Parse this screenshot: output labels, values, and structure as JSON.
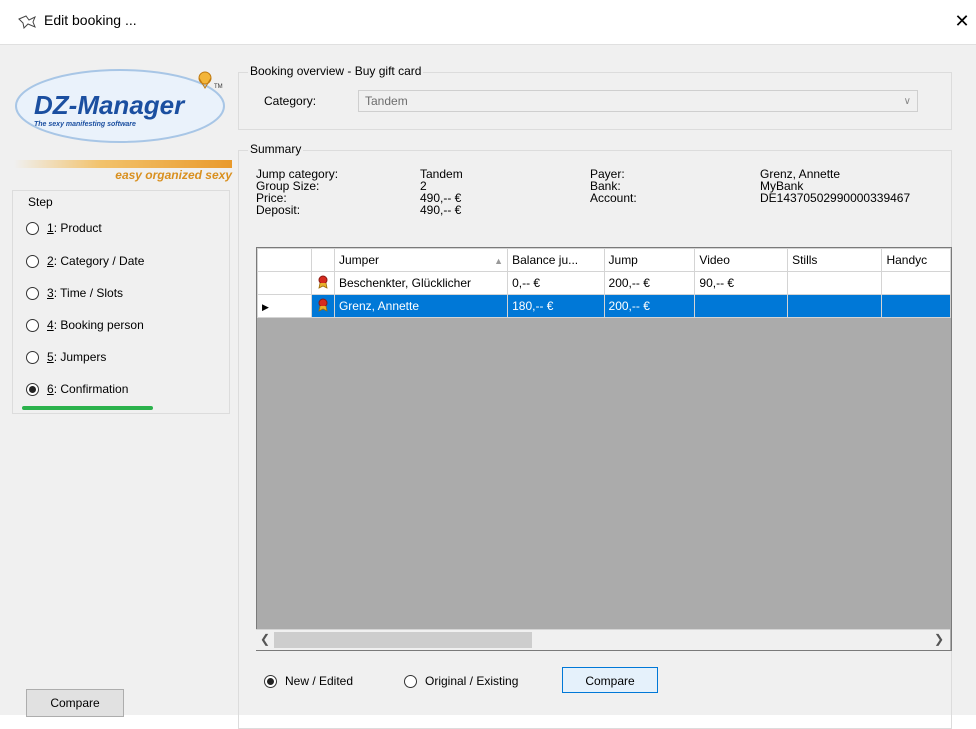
{
  "window": {
    "title": "Edit booking ...",
    "close_glyph": "✕"
  },
  "logo": {
    "name": "DZ-Manager",
    "tm": "TM",
    "slogan": "The sexy manifesting software",
    "tagline": "easy organized sexy"
  },
  "steps": {
    "legend": "Step",
    "items": [
      {
        "num": "1",
        "label": ": Product",
        "checked": false
      },
      {
        "num": "2",
        "label": ": Category / Date",
        "checked": false
      },
      {
        "num": "3",
        "label": ": Time / Slots",
        "checked": false
      },
      {
        "num": "4",
        "label": ": Booking person",
        "checked": false
      },
      {
        "num": "5",
        "label": ": Jumpers",
        "checked": false
      },
      {
        "num": "6",
        "label": ": Confirmation",
        "checked": true
      }
    ],
    "compare_button": "Compare"
  },
  "overview": {
    "legend": "Booking overview - Buy gift card",
    "category_label": "Category:",
    "category_value": "Tandem"
  },
  "summary": {
    "legend": "Summary",
    "left_labels": [
      "Jump category:",
      "Group Size:",
      "Price:",
      "Deposit:"
    ],
    "left_values": [
      "Tandem",
      "2",
      "490,-- €",
      "490,-- €"
    ],
    "right_labels": [
      "Payer:",
      "Bank:",
      "Account:"
    ],
    "right_values": [
      "Grenz, Annette",
      "MyBank",
      "DE14370502990000339467"
    ]
  },
  "grid": {
    "columns": [
      "Jumper",
      "Balance ju...",
      "Jump",
      "Video",
      "Stills",
      "Handyc"
    ],
    "rows": [
      {
        "jumper": "Beschenkter, Glücklicher",
        "balance": "0,-- €",
        "jump": "200,-- €",
        "video": "90,-- €",
        "stills": "",
        "handycam": "",
        "selected": false
      },
      {
        "jumper": "Grenz, Annette",
        "balance": "180,-- €",
        "jump": "200,-- €",
        "video": "",
        "stills": "",
        "handycam": "",
        "selected": true
      }
    ]
  },
  "bottom": {
    "radio_new": "New / Edited",
    "radio_original": "Original / Existing",
    "compare_button": "Compare"
  },
  "colors": {
    "selection": "#0078d7",
    "balance_green": "#1a9e3b",
    "confirm_underline": "#2bb24c",
    "logo_blue": "#1b4fa0"
  }
}
